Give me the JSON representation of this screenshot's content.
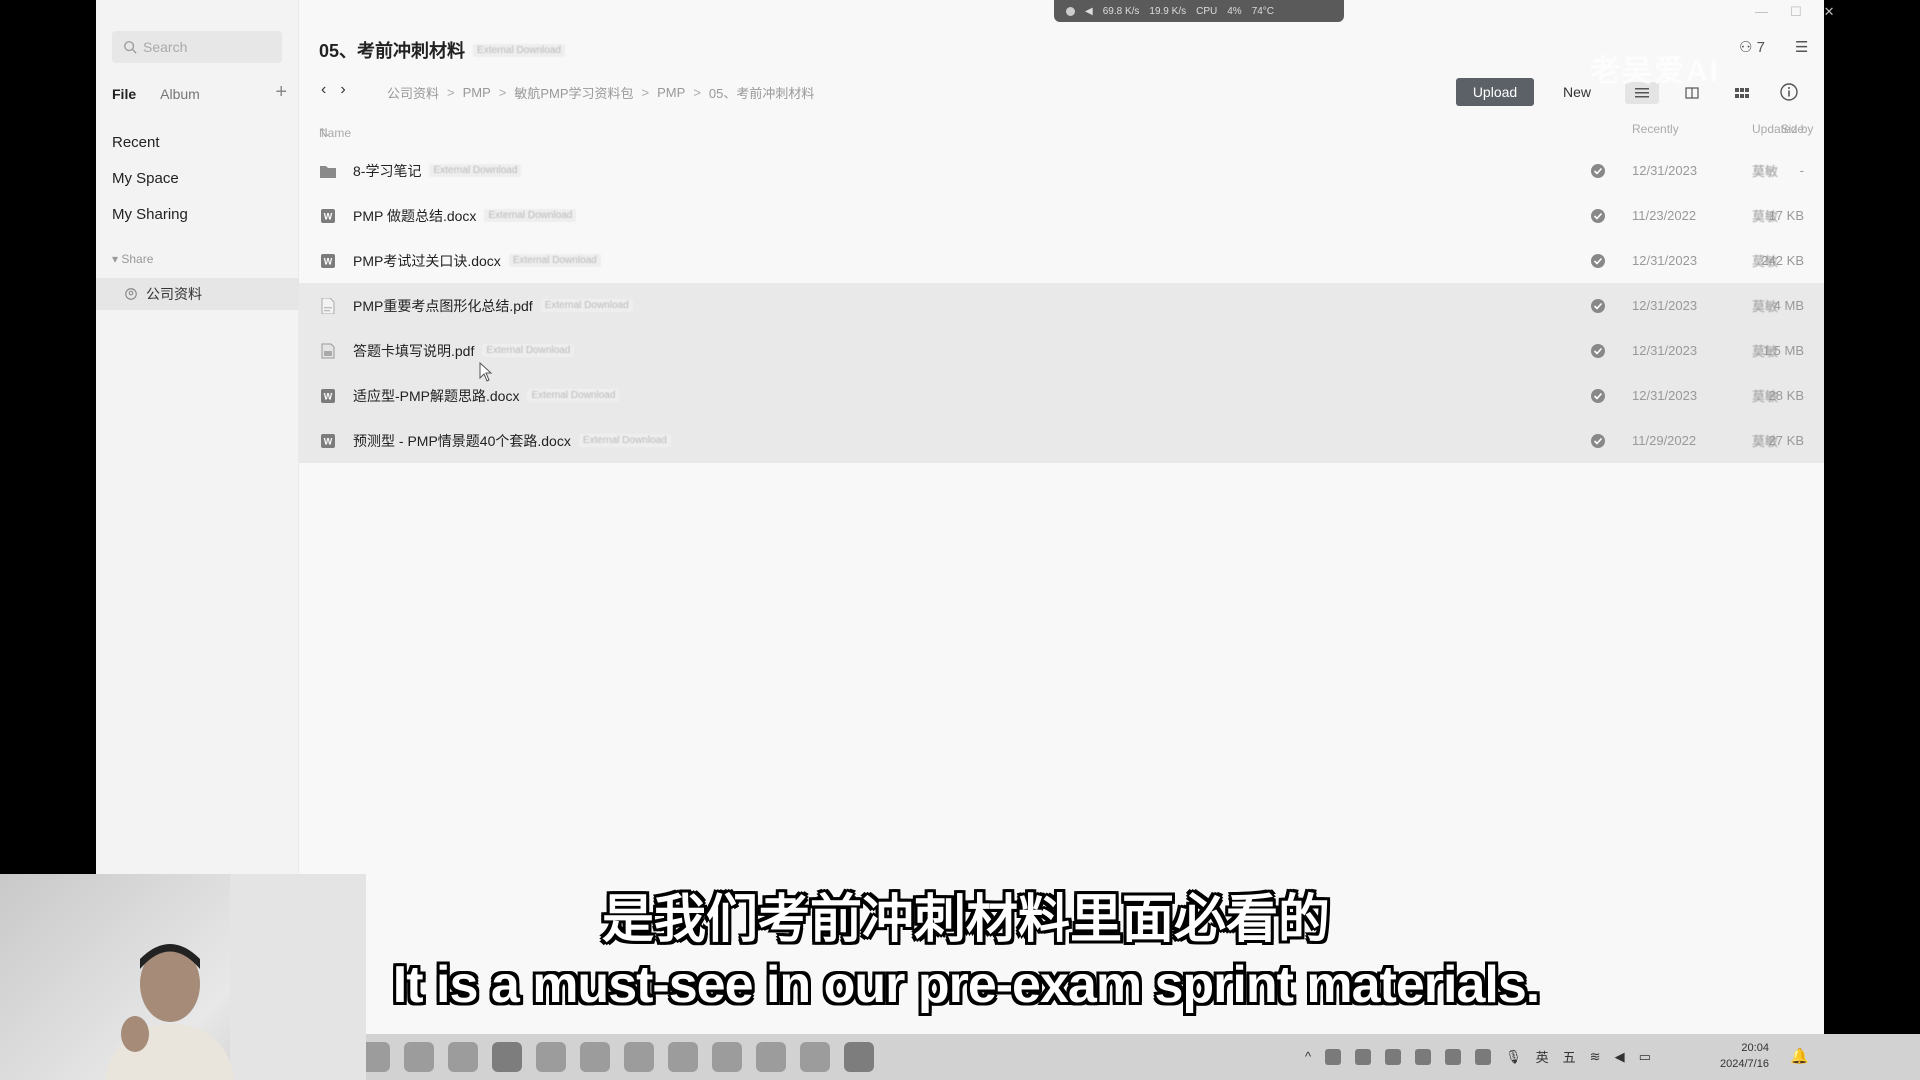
{
  "sidebar": {
    "search_placeholder": "Search",
    "tabs": [
      {
        "label": "File"
      },
      {
        "label": "Album"
      }
    ],
    "add_label": "+",
    "nav": [
      {
        "label": "Recent"
      },
      {
        "label": "My Space"
      },
      {
        "label": "My Sharing"
      }
    ],
    "share_section": "Share",
    "share_items": [
      {
        "label": "公司资料"
      }
    ]
  },
  "header": {
    "title": "05、考前冲刺材料",
    "title_tag": "External Download",
    "breadcrumb": [
      "公司资料",
      "PMP",
      "敏航PMP学习资料包",
      "PMP",
      "05、考前冲刺材料"
    ],
    "breadcrumb_sep": ">",
    "upload_label": "Upload",
    "new_label": "New",
    "members_count": "7"
  },
  "table": {
    "columns": {
      "name": "Name",
      "recently": "Recently",
      "updated_by": "Updated by",
      "size": "Size"
    },
    "rows": [
      {
        "name": "8-学习笔记",
        "tag": "External Download",
        "type": "folder",
        "date": "12/31/2023",
        "user": "莫敏",
        "size": "-"
      },
      {
        "name": "PMP 做题总结.docx",
        "tag": "External Download",
        "type": "docx",
        "date": "11/23/2022",
        "user": "莫敏",
        "size": "17 KB"
      },
      {
        "name": "PMP考试过关口诀.docx",
        "tag": "External Download",
        "type": "docx",
        "date": "12/31/2023",
        "user": "莫敏",
        "size": "242 KB"
      },
      {
        "name": "PMP重要考点图形化总结.pdf",
        "tag": "External Download",
        "type": "pdf",
        "date": "12/31/2023",
        "user": "莫敏",
        "size": "4 MB"
      },
      {
        "name": "答题卡填写说明.pdf",
        "tag": "External Download",
        "type": "pdf",
        "date": "12/31/2023",
        "user": "莫敏",
        "size": "1.5 MB"
      },
      {
        "name": "适应型-PMP解题思路.docx",
        "tag": "External Download",
        "type": "docx",
        "date": "12/31/2023",
        "user": "莫敏",
        "size": "28 KB"
      },
      {
        "name": "预测型 - PMP情景题40个套路.docx",
        "tag": "External Download",
        "type": "docx",
        "date": "11/29/2022",
        "user": "莫敏",
        "size": "27 KB"
      }
    ]
  },
  "system": {
    "net_up": "69.8 K/s",
    "net_down": "19.9 K/s",
    "cpu_label": "CPU",
    "cpu": "4%",
    "temp": "74°C",
    "watermark": "老吴爱AI",
    "clock_time": "20:04",
    "clock_date": "2024/7/16",
    "tray_lang": "英",
    "tray_ime": "五"
  },
  "subtitles": {
    "cn": "是我们考前冲刺材料里面必看的",
    "en": "It is a must-see in our pre-exam sprint materials."
  },
  "colors": {
    "upload_bg": "#5b6167",
    "row_highlight": "#e9e9e9",
    "sidebar_bg": "#f3f3f3"
  }
}
